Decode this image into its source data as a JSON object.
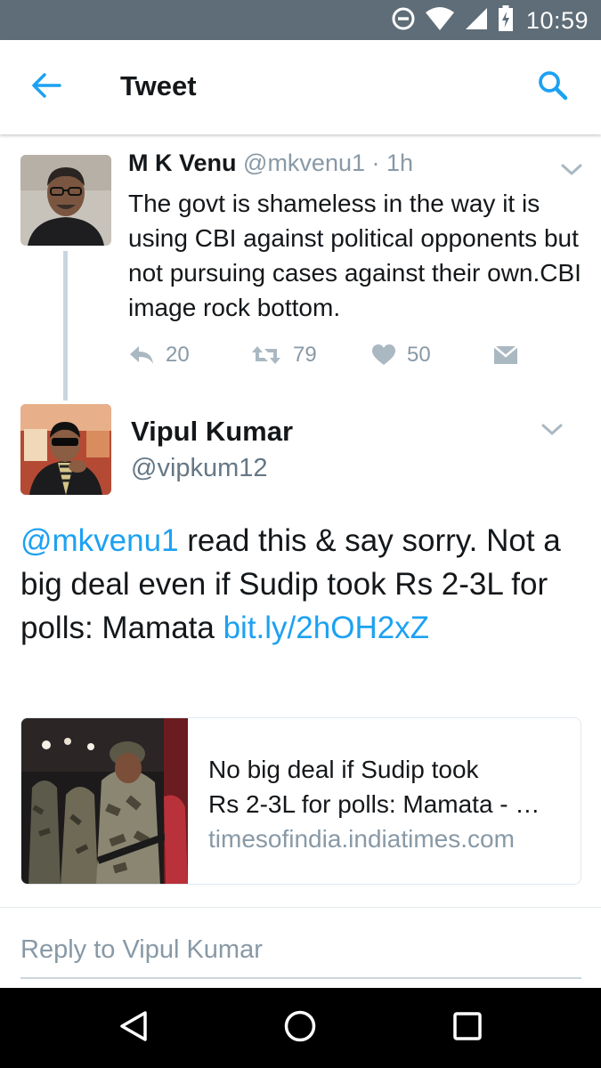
{
  "status_bar": {
    "time": "10:59",
    "icons": [
      "do-not-disturb-icon",
      "wifi-icon",
      "cellular-signal-icon",
      "battery-charging-icon"
    ]
  },
  "header": {
    "title": "Tweet",
    "back_icon": "back-arrow-icon",
    "search_icon": "search-icon"
  },
  "parent_tweet": {
    "name": "M K Venu",
    "handle": "@mkvenu1",
    "separator": "·",
    "time": "1h",
    "text": "The govt is shameless in the way it is using CBI against political opponents but not pursuing cases against their own.CBI image rock bottom.",
    "actions": {
      "reply_count": "20",
      "retweet_count": "79",
      "like_count": "50"
    }
  },
  "main_tweet": {
    "name": "Vipul Kumar",
    "handle": "@vipkum12",
    "mention": "@mkvenu1",
    "text": " read this & say sorry. Not a big deal even if Sudip took Rs 2-3L for polls: Mamata ",
    "link": "bit.ly/2hOH2xZ"
  },
  "link_card": {
    "title_line1": "No big deal if Sudip took",
    "title_line2": "Rs 2-3L for polls: Mamata - …",
    "domain": "timesofindia.indiatimes.com"
  },
  "reply": {
    "placeholder": "Reply to Vipul Kumar"
  },
  "colors": {
    "accent": "#1da1f2",
    "status_bar": "#5e6d77",
    "muted_text": "#8899a6",
    "nav_bar": "#000000"
  }
}
